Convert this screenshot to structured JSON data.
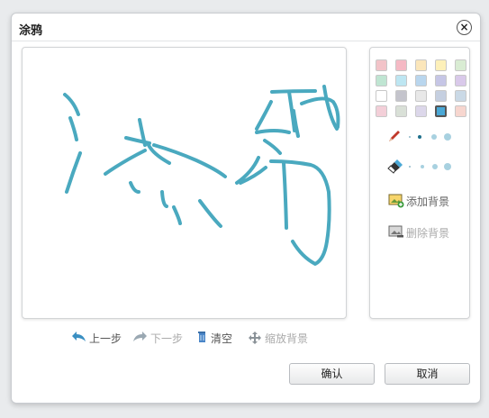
{
  "dialog": {
    "title": "涂鸦",
    "close_glyph": "×"
  },
  "palette": {
    "colors": [
      "#f2c3c8",
      "#f5b9c4",
      "#fbe6ba",
      "#fdf0b9",
      "#d9ecd3",
      "#bfe5d2",
      "#bde6f2",
      "#b9d6ee",
      "#c6c6e6",
      "#d9c9ea",
      "#ffffff",
      "#c4c4cc",
      "#e8e8e8",
      "#c5cfe0",
      "#cad9e6",
      "#f3cfd8",
      "#d9e0d7",
      "#dcd7ea",
      "#4aa8d6",
      "#f7d6cf"
    ],
    "selected_color": "#4aa8d6"
  },
  "brush_icon": "pencil-icon",
  "eraser_icon": "eraser-icon",
  "tools": {
    "add_background": "添加背景",
    "remove_background": "删除背景"
  },
  "bottom_toolbar": {
    "undo": "上一步",
    "redo": "下一步",
    "clear": "清空",
    "scale_background": "缩放背景"
  },
  "buttons": {
    "confirm": "确认",
    "cancel": "取消"
  },
  "stroke_color": "#4aa9bf"
}
